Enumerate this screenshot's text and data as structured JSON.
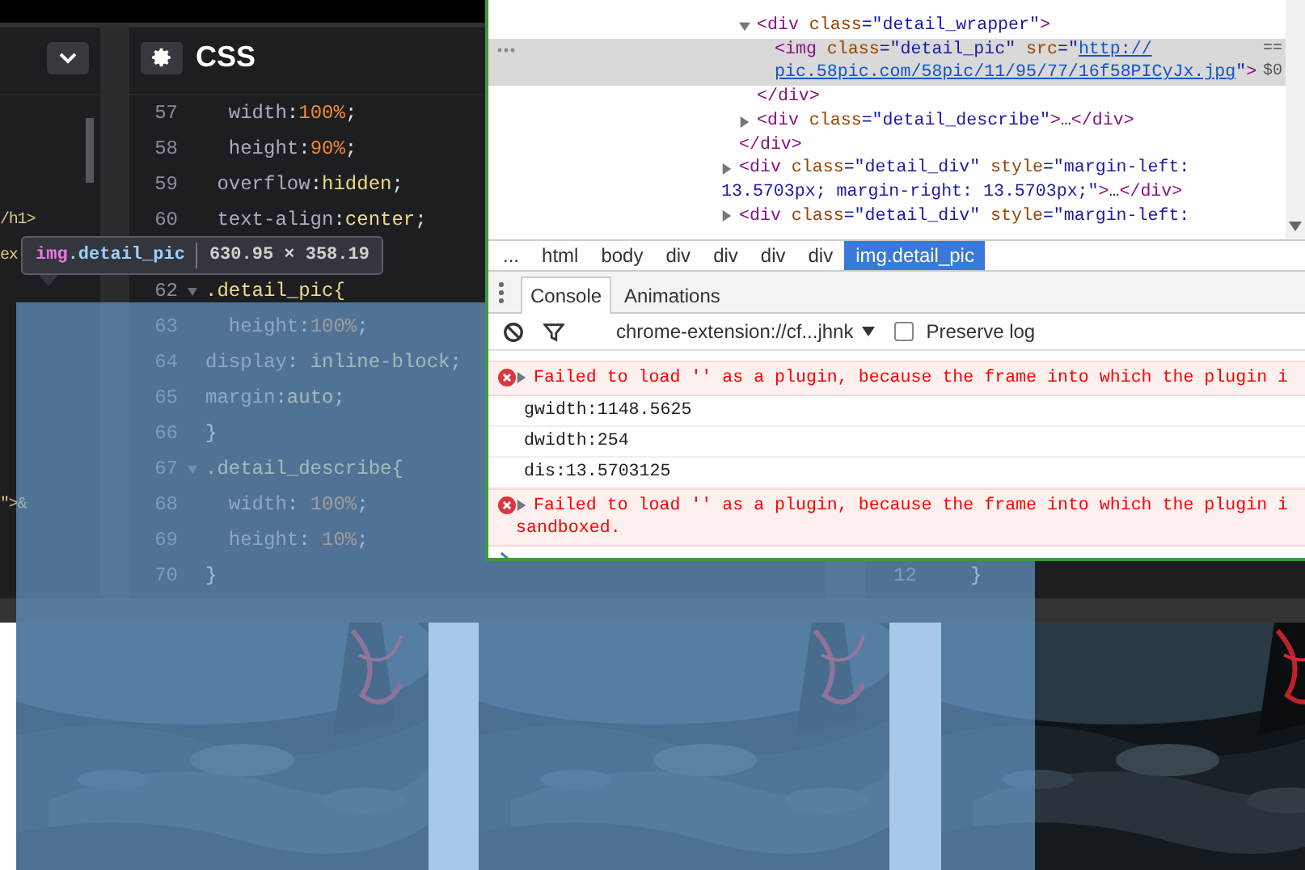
{
  "editor": {
    "css_title": "CSS",
    "lines": [
      {
        "number": "57",
        "foldable": false,
        "parts": [
          {
            "kind": "property",
            "text": "  width"
          },
          {
            "kind": "punct",
            "text": ":"
          },
          {
            "kind": "number",
            "text": "100%"
          },
          {
            "kind": "punct",
            "text": ";"
          }
        ]
      },
      {
        "number": "58",
        "foldable": false,
        "parts": [
          {
            "kind": "property",
            "text": "  height"
          },
          {
            "kind": "punct",
            "text": ":"
          },
          {
            "kind": "number",
            "text": "90%"
          },
          {
            "kind": "punct",
            "text": ";"
          }
        ]
      },
      {
        "number": "59",
        "foldable": false,
        "parts": [
          {
            "kind": "property",
            "text": " overflow"
          },
          {
            "kind": "punct",
            "text": ":"
          },
          {
            "kind": "keyword",
            "text": "hidden"
          },
          {
            "kind": "punct",
            "text": ";"
          }
        ]
      },
      {
        "number": "60",
        "foldable": false,
        "html_fragment": "/h1>",
        "parts": [
          {
            "kind": "property",
            "text": " text-align"
          },
          {
            "kind": "punct",
            "text": ":"
          },
          {
            "kind": "keyword",
            "text": "center"
          },
          {
            "kind": "punct",
            "text": ";"
          }
        ]
      },
      {
        "foldable": false,
        "html_fragment": "ex"
      },
      {
        "number": "62",
        "foldable": true,
        "parts": [
          {
            "kind": "selector",
            "text": ".detail_pic{"
          }
        ]
      },
      {
        "number": "63",
        "foldable": false,
        "parts": [
          {
            "kind": "property",
            "text": "  height"
          },
          {
            "kind": "punct",
            "text": ":"
          },
          {
            "kind": "number",
            "text": "100%"
          },
          {
            "kind": "punct",
            "text": ";"
          }
        ]
      },
      {
        "number": "64",
        "foldable": false,
        "parts": [
          {
            "kind": "property",
            "text": "display"
          },
          {
            "kind": "punct",
            "text": ": "
          },
          {
            "kind": "keyword",
            "text": "inline-block"
          },
          {
            "kind": "punct",
            "text": ";"
          }
        ]
      },
      {
        "number": "65",
        "foldable": false,
        "parts": [
          {
            "kind": "property",
            "text": "margin"
          },
          {
            "kind": "punct",
            "text": ":"
          },
          {
            "kind": "keyword",
            "text": "auto"
          },
          {
            "kind": "punct",
            "text": ";"
          }
        ]
      },
      {
        "number": "66",
        "foldable": false,
        "parts": [
          {
            "kind": "punct",
            "text": "}"
          }
        ]
      },
      {
        "number": "67",
        "foldable": true,
        "parts": [
          {
            "kind": "selector",
            "text": ".detail_describe{"
          }
        ]
      },
      {
        "number": "68",
        "foldable": false,
        "html_fragment": "\">&",
        "parts": [
          {
            "kind": "property",
            "text": "  width"
          },
          {
            "kind": "punct",
            "text": ": "
          },
          {
            "kind": "number",
            "text": "100%"
          },
          {
            "kind": "punct",
            "text": ";"
          }
        ]
      },
      {
        "number": "69",
        "foldable": false,
        "parts": [
          {
            "kind": "property",
            "text": "  height"
          },
          {
            "kind": "punct",
            "text": ": "
          },
          {
            "kind": "number",
            "text": "10%"
          },
          {
            "kind": "punct",
            "text": ";"
          }
        ]
      },
      {
        "number": "70",
        "foldable": false,
        "js_number": "12",
        "js_code": "}",
        "parts": [
          {
            "kind": "punct",
            "text": "}"
          }
        ]
      }
    ]
  },
  "tooltip": {
    "tag": "img",
    "classes": ".detail_pic",
    "size": "630.95 × 358.19"
  },
  "devtools": {
    "elements": [
      {
        "kind": "continuation",
        "children": [
          {
            "kind": "element",
            "expanded": true,
            "selected": false,
            "lines": [
              [
                {
                  "kind": "tag",
                  "text": "<div"
                },
                {
                  "kind": "attr",
                  "text": " class"
                },
                {
                  "kind": "value",
                  "text": "=\"detail_wrapper\""
                },
                {
                  "kind": "tag",
                  "text": ">"
                }
              ]
            ],
            "children": [
              {
                "kind": "element",
                "selected": true,
                "suffix": "== $0",
                "lines": [
                  [
                    {
                      "kind": "tag",
                      "text": "<img"
                    },
                    {
                      "kind": "attr",
                      "text": " class"
                    },
                    {
                      "kind": "value",
                      "text": "=\"detail_pic\""
                    },
                    {
                      "kind": "attr",
                      "text": " src"
                    },
                    {
                      "kind": "value",
                      "text": "=\""
                    },
                    {
                      "kind": "link",
                      "text": "http://"
                    }
                  ],
                  [
                    {
                      "kind": "link",
                      "text": "pic.58pic.com/58pic/11/95/77/16f58PICyJx.jpg"
                    },
                    {
                      "kind": "value",
                      "text": "\""
                    },
                    {
                      "kind": "tag",
                      "text": ">"
                    }
                  ]
                ]
              }
            ],
            "closing": [
              {
                "kind": "tag",
                "text": "</div>"
              }
            ]
          },
          {
            "kind": "element",
            "expanded": false,
            "selected": false,
            "lines": [
              [
                {
                  "kind": "tag",
                  "text": "<div"
                },
                {
                  "kind": "attr",
                  "text": " class"
                },
                {
                  "kind": "value",
                  "text": "=\"detail_describe\""
                },
                {
                  "kind": "tag",
                  "text": ">"
                },
                {
                  "kind": "text",
                  "text": "…"
                },
                {
                  "kind": "tag",
                  "text": "</div>"
                }
              ]
            ]
          }
        ],
        "closing": [
          {
            "kind": "tag",
            "text": "</div>"
          }
        ]
      },
      {
        "kind": "element",
        "expanded": false,
        "selected": false,
        "lines": [
          [
            {
              "kind": "tag",
              "text": "<div"
            },
            {
              "kind": "attr",
              "text": " class"
            },
            {
              "kind": "value",
              "text": "=\"detail_div\""
            },
            {
              "kind": "attr",
              "text": " style"
            },
            {
              "kind": "value",
              "text": "=\"margin-left:"
            }
          ],
          [
            {
              "kind": "value",
              "text": "13.5703px; margin-right: 13.5703px;\""
            },
            {
              "kind": "tag",
              "text": ">"
            },
            {
              "kind": "text",
              "text": "…"
            },
            {
              "kind": "tag",
              "text": "</div>"
            }
          ]
        ]
      },
      {
        "kind": "element",
        "expanded": false,
        "selected": false,
        "lines": [
          [
            {
              "kind": "tag",
              "text": "<div"
            },
            {
              "kind": "attr",
              "text": " class"
            },
            {
              "kind": "value",
              "text": "=\"detail_div\""
            },
            {
              "kind": "attr",
              "text": " style"
            },
            {
              "kind": "value",
              "text": "=\"margin-left:"
            }
          ]
        ]
      }
    ],
    "breadcrumbs": [
      {
        "label": "...",
        "selected": false
      },
      {
        "label": "html",
        "selected": false
      },
      {
        "label": "body",
        "selected": false
      },
      {
        "label": "div",
        "selected": false
      },
      {
        "label": "div",
        "selected": false
      },
      {
        "label": "div",
        "selected": false
      },
      {
        "label": "div",
        "selected": false
      },
      {
        "label": "img.detail_pic",
        "selected": true
      }
    ],
    "drawer_tabs": [
      {
        "label": "Console",
        "selected": true
      },
      {
        "label": "Animations",
        "selected": false
      }
    ],
    "context": "chrome-extension://cf...jhnk",
    "preserve_log": {
      "label": "Preserve log",
      "checked": false
    },
    "messages": [
      {
        "kind": "error",
        "expandable": true,
        "lines": [
          "Failed to load '' as a plugin, because the frame into which the plugin i"
        ]
      },
      {
        "kind": "log",
        "lines": [
          "gwidth:1148.5625"
        ]
      },
      {
        "kind": "log",
        "lines": [
          "dwidth:254"
        ]
      },
      {
        "kind": "log",
        "lines": [
          "dis:13.5703125"
        ]
      },
      {
        "kind": "error",
        "expandable": true,
        "lines": [
          "Failed to load '' as a plugin, because the frame into which the plugin i",
          "sandboxed."
        ]
      }
    ]
  }
}
